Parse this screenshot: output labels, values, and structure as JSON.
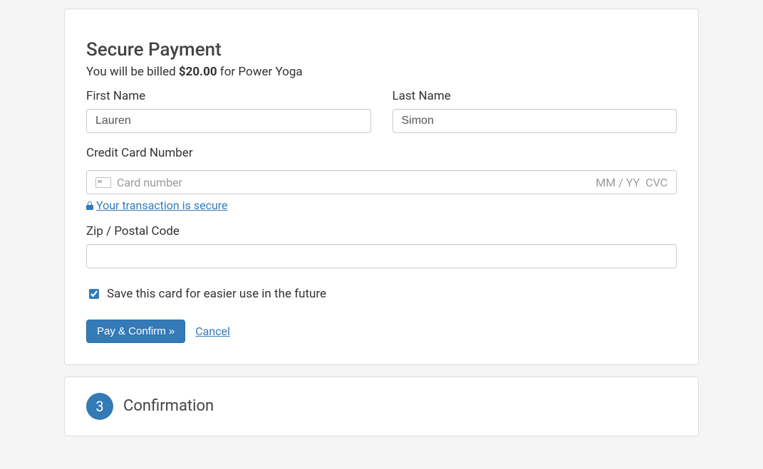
{
  "payment": {
    "heading": "Secure Payment",
    "subtitle_prefix": "You will be billed ",
    "amount": "$20.00",
    "subtitle_suffix": " for Power Yoga",
    "first_name_label": "First Name",
    "first_name_value": "Lauren",
    "last_name_label": "Last Name",
    "last_name_value": "Simon",
    "cc_label": "Credit Card Number",
    "cc_placeholder": "Card number",
    "cc_expiry_placeholder": "MM / YY",
    "cc_cvc_placeholder": "CVC",
    "secure_link": "Your transaction is secure",
    "zip_label": "Zip / Postal Code",
    "zip_value": "",
    "save_card_label": "Save this card for easier use in the future",
    "save_card_checked": true,
    "submit_label": "Pay & Confirm »",
    "cancel_label": "Cancel"
  },
  "confirmation": {
    "step_number": "3",
    "title": "Confirmation"
  }
}
